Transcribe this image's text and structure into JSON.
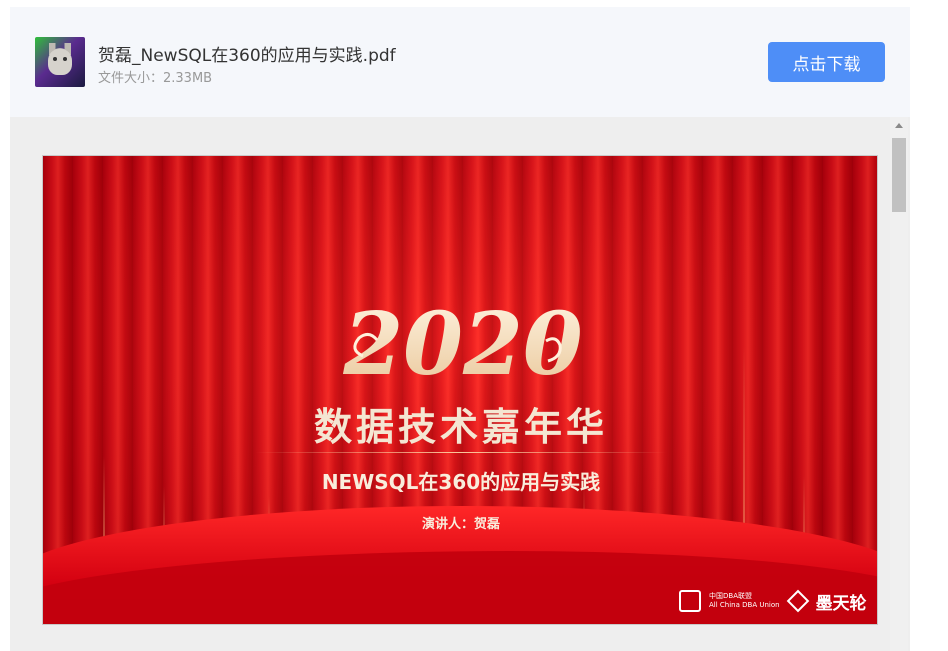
{
  "file": {
    "name": "贺磊_NewSQL在360的应用与实践.pdf",
    "size_label": "文件大小：2.33MB"
  },
  "actions": {
    "download_label": "点击下载"
  },
  "slide": {
    "logo_text": "2020",
    "title": "数据技术嘉年华",
    "subtitle": "NEWSQL在360的应用与实践",
    "speaker": "演讲人：贺磊",
    "sponsor1_line1": "中国DBA联盟",
    "sponsor1_line2": "All China DBA Union",
    "sponsor2": "墨天轮"
  }
}
